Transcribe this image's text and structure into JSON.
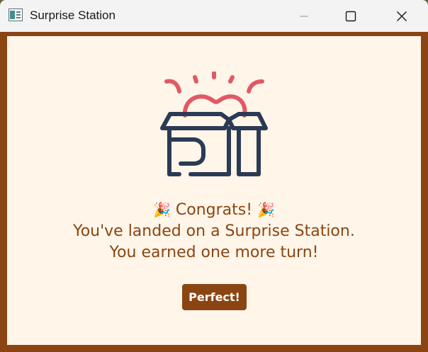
{
  "window": {
    "title": "Surprise Station",
    "controls": {
      "minimize_icon": "minimize-icon",
      "maximize_icon": "maximize-icon",
      "close_icon": "close-icon"
    }
  },
  "dialog": {
    "illustration_icon": "gift-box-heart-icon",
    "party_emoji": "🎉",
    "line1_text": "Congrats!",
    "line2": "You've landed on a Surprise Station.",
    "line3": "You earned one more turn!",
    "button_label": "Perfect!"
  },
  "colors": {
    "accent": "#8b4513",
    "background": "#fff5e8",
    "heart": "#e05a66",
    "box_stroke": "#2b3a55",
    "titlebar": "#f3f3f3"
  }
}
